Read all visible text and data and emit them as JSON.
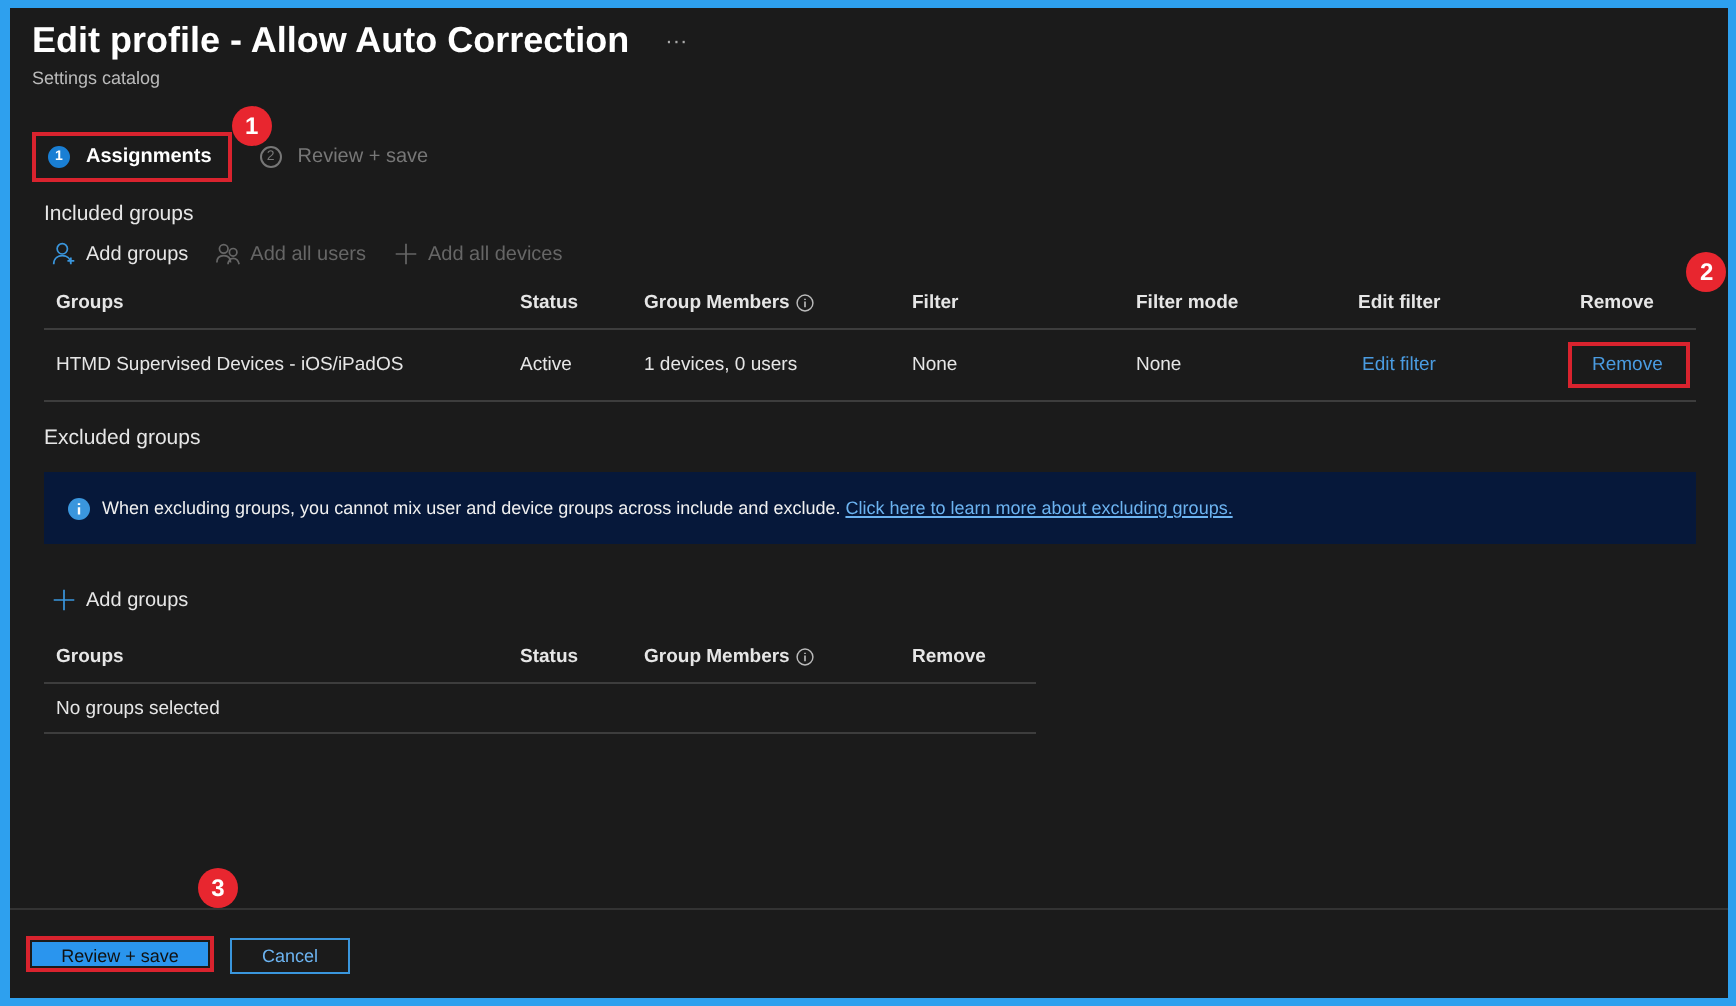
{
  "header": {
    "title": "Edit profile - Allow Auto Correction",
    "more": "···",
    "subtitle": "Settings catalog"
  },
  "steps": [
    {
      "number": "1",
      "label": "Assignments",
      "selected": true,
      "highlighted": true,
      "callout": "1"
    },
    {
      "number": "2",
      "label": "Review + save",
      "selected": false,
      "highlighted": false
    }
  ],
  "included": {
    "heading": "Included groups",
    "toolbar": [
      {
        "kind": "user",
        "label": "Add groups",
        "disabled": false
      },
      {
        "kind": "users",
        "label": "Add all users",
        "disabled": true
      },
      {
        "kind": "plus",
        "label": "Add all devices",
        "disabled": true
      }
    ],
    "columns": [
      {
        "label": "Groups",
        "info": false
      },
      {
        "label": "Status",
        "info": false
      },
      {
        "label": "Group Members",
        "info": true
      },
      {
        "label": "Filter",
        "info": false
      },
      {
        "label": "Filter mode",
        "info": false
      },
      {
        "label": "Edit filter",
        "info": false
      },
      {
        "label": "Remove",
        "info": false
      }
    ],
    "rows": [
      {
        "cells": [
          {
            "kind": "text",
            "text": "HTMD Supervised Devices - iOS/iPadOS"
          },
          {
            "kind": "text",
            "text": "Active"
          },
          {
            "kind": "text",
            "text": "1 devices, 0 users"
          },
          {
            "kind": "text",
            "text": "None"
          },
          {
            "kind": "text",
            "text": "None"
          },
          {
            "kind": "link",
            "text": "Edit filter"
          },
          {
            "kind": "link",
            "text": "Remove",
            "highlighted": true,
            "callout": "2"
          }
        ]
      }
    ]
  },
  "excluded": {
    "heading": "Excluded groups",
    "banner": {
      "text": "When excluding groups, you cannot mix user and device groups across include and exclude.",
      "link": "Click here to learn more about excluding groups."
    },
    "toolbar": [
      {
        "kind": "plus",
        "label": "Add groups",
        "disabled": false
      }
    ],
    "columns": [
      {
        "label": "Groups",
        "info": false
      },
      {
        "label": "Status",
        "info": false
      },
      {
        "label": "Group Members",
        "info": true
      },
      {
        "label": "Remove",
        "info": false
      }
    ],
    "empty": "No groups selected"
  },
  "footer": {
    "buttons": [
      {
        "kind": "primary",
        "label": "Review + save",
        "highlighted": true,
        "callout": "3"
      },
      {
        "kind": "secondary",
        "label": "Cancel",
        "highlighted": false
      }
    ]
  }
}
